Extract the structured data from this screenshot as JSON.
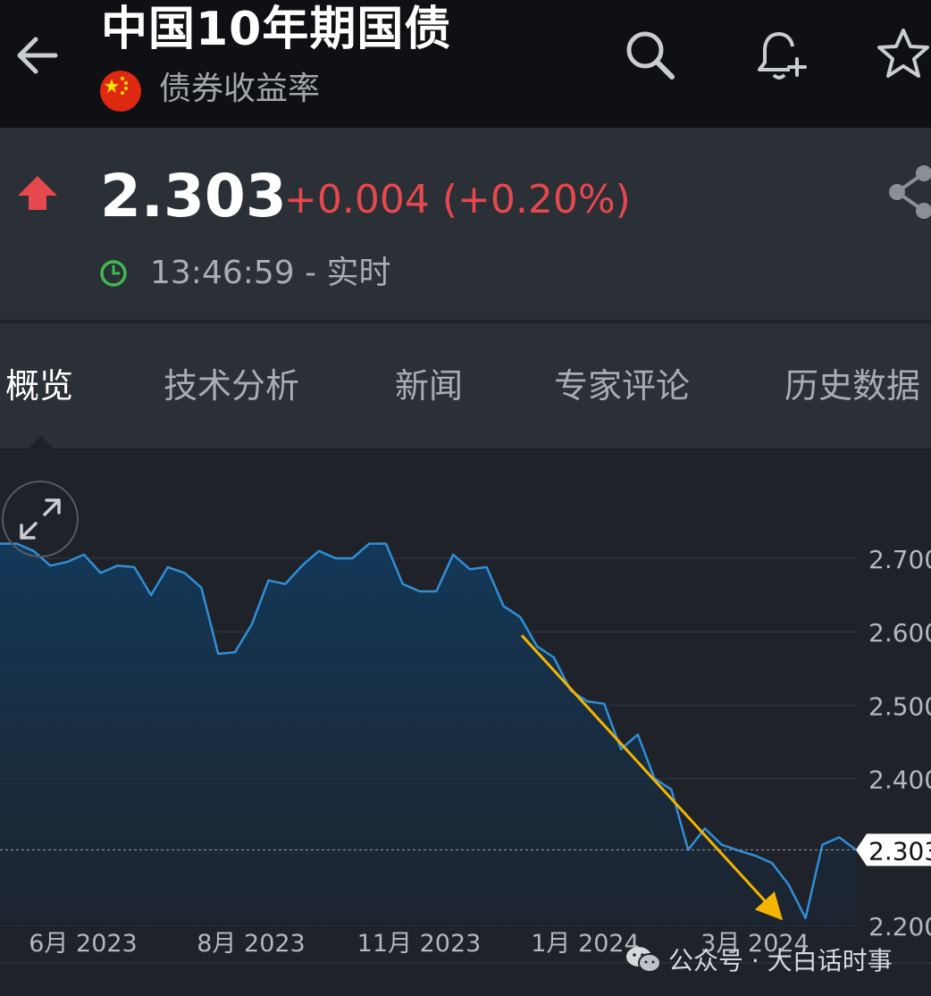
{
  "header": {
    "title": "中国10年期国债",
    "subtitle": "债券收益率",
    "icons": [
      "back-arrow-icon",
      "search-icon",
      "alert-add-icon",
      "star-icon"
    ]
  },
  "quote": {
    "price": "2.303",
    "change": "+0.004 (+0.20%)",
    "timestamp": "13:46:59 - 实时",
    "colors": {
      "up": "#e5484d",
      "clock": "#3fb950",
      "line": "#2f8fd8",
      "annotation_arrow": "#f5b400"
    }
  },
  "tabs": [
    {
      "label": "概览",
      "active": true
    },
    {
      "label": "技术分析",
      "active": false
    },
    {
      "label": "新闻",
      "active": false
    },
    {
      "label": "专家评论",
      "active": false
    },
    {
      "label": "历史数据",
      "active": false
    }
  ],
  "watermark": {
    "text": "公众号 · 大白话时事"
  },
  "chart_data": {
    "type": "area",
    "title": "",
    "xlabel": "",
    "ylabel": "",
    "y_ticks": [
      "2.700",
      "2.600",
      "2.500",
      "2.400",
      "2.200"
    ],
    "x_ticks": [
      "6月 2023",
      "8月 2023",
      "11月 2023",
      "1月 2024",
      "3月 2024"
    ],
    "ylim": [
      2.18,
      2.73
    ],
    "grid": true,
    "current_value_label": "2.303",
    "current_value": 2.303,
    "series": [
      {
        "values": [
          2.72,
          2.72,
          2.71,
          2.69,
          2.695,
          2.705,
          2.68,
          2.69,
          2.688,
          2.65,
          2.688,
          2.68,
          2.66,
          2.57,
          2.572,
          2.61,
          2.67,
          2.665,
          2.69,
          2.71,
          2.7,
          2.7,
          2.72,
          2.72,
          2.665,
          2.655,
          2.655,
          2.705,
          2.685,
          2.688,
          2.635,
          2.62,
          2.58,
          2.565,
          2.52,
          2.505,
          2.502,
          2.44,
          2.46,
          2.4,
          2.385,
          2.303,
          2.332,
          2.31,
          2.302,
          2.295,
          2.285,
          2.255,
          2.21,
          2.31,
          2.32,
          2.303
        ]
      }
    ],
    "annotations": [
      {
        "type": "trend-arrow",
        "from_value": 2.595,
        "to_value": 2.215
      }
    ]
  }
}
